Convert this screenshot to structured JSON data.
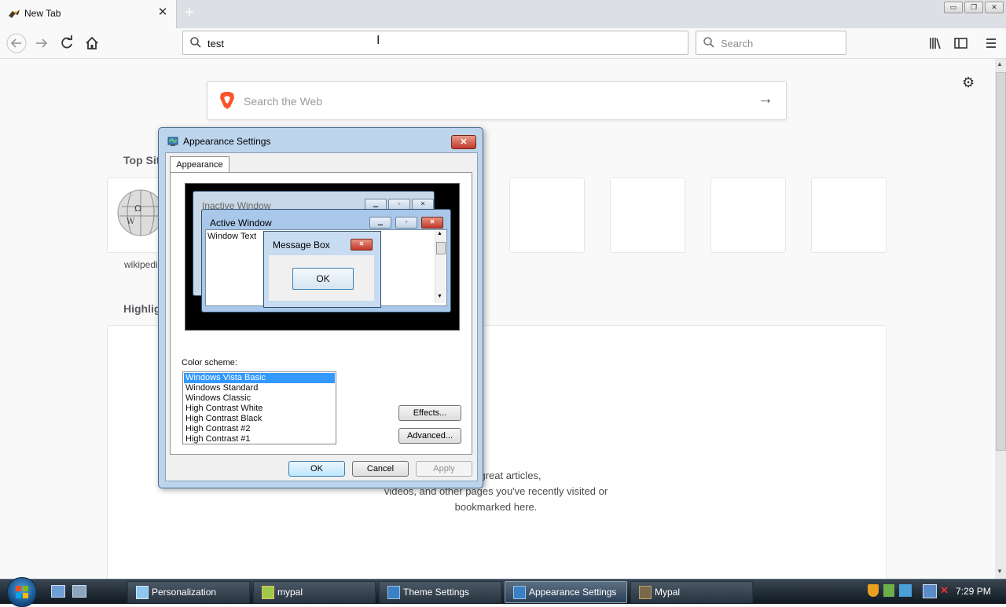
{
  "browser": {
    "tab_title": "New Tab",
    "tab_close": "✕",
    "new_tab": "+",
    "window_controls": [
      "▭",
      "❐",
      "✕"
    ],
    "url_value": "test",
    "search_placeholder": "Search",
    "toolbar_icons": [
      "library-icon",
      "sidebar-icon",
      "menu-icon"
    ]
  },
  "page": {
    "web_search_placeholder": "Search the Web",
    "top_sites_title": "Top Sit",
    "top_site_label": "wikipedi",
    "highlights_title": "Highlig",
    "highlights_text": [
      "show some of the great articles,",
      "videos, and other pages you've recently visited or",
      "bookmarked here."
    ]
  },
  "dialog": {
    "title": "Appearance Settings",
    "close": "✕",
    "tab": "Appearance",
    "preview": {
      "inactive_window": "Inactive Window",
      "active_window": "Active Window",
      "window_text": "Window Text",
      "message_box": "Message Box",
      "ok": "OK"
    },
    "color_scheme_label": "Color scheme:",
    "color_schemes": [
      "Windows Vista Basic",
      "Windows Standard",
      "Windows Classic",
      "High Contrast White",
      "High Contrast Black",
      "High Contrast #2",
      "High Contrast #1"
    ],
    "selected_scheme": "Windows Vista Basic",
    "effects_button": "Effects...",
    "advanced_button": "Advanced...",
    "ok_button": "OK",
    "cancel_button": "Cancel",
    "apply_button": "Apply"
  },
  "taskbar": {
    "items": [
      {
        "label": "Personalization",
        "active": false
      },
      {
        "label": "mypal",
        "active": false
      },
      {
        "label": "Theme Settings",
        "active": false
      },
      {
        "label": "Appearance Settings",
        "active": true
      },
      {
        "label": "Mypal",
        "active": false
      }
    ],
    "clock": "7:29 PM"
  },
  "colors": {
    "accent": "#3399ff",
    "brave_orange": "#fb542b",
    "dialog_frame": "#bcd4ec"
  }
}
